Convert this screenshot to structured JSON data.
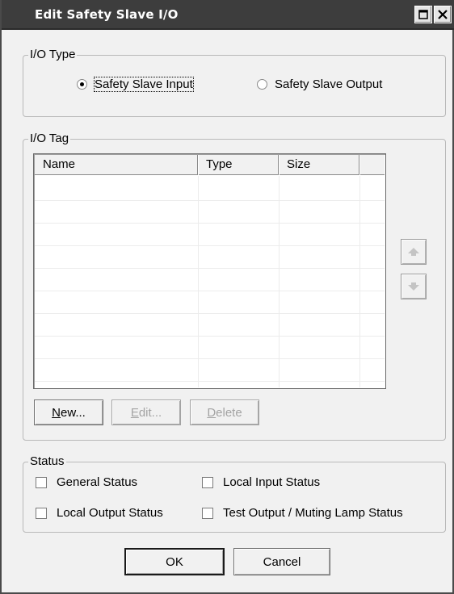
{
  "window": {
    "title": "Edit Safety Slave I/O",
    "titlebar_color": "#3d3d3d"
  },
  "io_type": {
    "group_label": "I/O Type",
    "options": [
      {
        "label": "Safety Slave Input",
        "selected": true
      },
      {
        "label": "Safety Slave Output",
        "selected": false
      }
    ]
  },
  "io_tag": {
    "group_label": "I/O Tag",
    "columns": [
      "Name",
      "Type",
      "Size"
    ],
    "rows": [],
    "buttons": {
      "new": {
        "label": "New...",
        "accel": "N",
        "rest": "ew...",
        "enabled": true
      },
      "edit": {
        "label": "Edit...",
        "accel": "E",
        "rest": "dit...",
        "enabled": false
      },
      "delete": {
        "label": "Delete",
        "accel": "D",
        "rest": "elete",
        "enabled": false
      }
    },
    "move_up_icon": "arrow-up-icon",
    "move_down_icon": "arrow-down-icon"
  },
  "status": {
    "group_label": "Status",
    "checks": [
      {
        "label": "General Status",
        "checked": false
      },
      {
        "label": "Local Input Status",
        "checked": false
      },
      {
        "label": "Local Output Status",
        "checked": false
      },
      {
        "label": "Test Output / Muting Lamp Status",
        "checked": false
      }
    ]
  },
  "footer": {
    "ok_label": "OK",
    "cancel_label": "Cancel"
  }
}
